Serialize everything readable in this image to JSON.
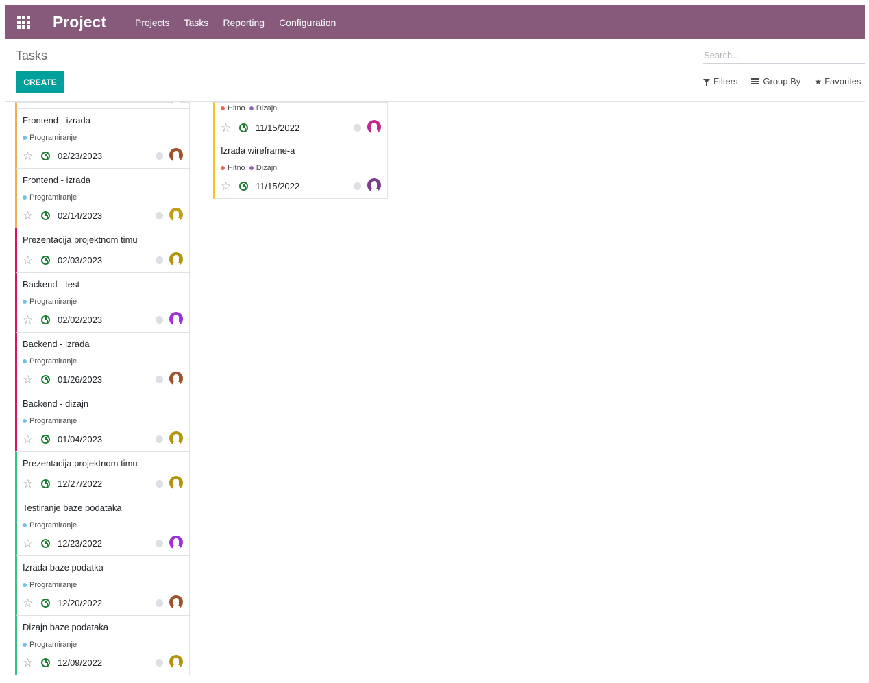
{
  "navbar": {
    "app_name": "Project",
    "menu": [
      "Projects",
      "Tasks",
      "Reporting",
      "Configuration"
    ]
  },
  "control_panel": {
    "breadcrumb": "Tasks",
    "create_label": "CREATE",
    "search_placeholder": "Search...",
    "filters_label": "Filters",
    "group_by_label": "Group By",
    "favorites_label": "Favorites"
  },
  "colors": {
    "navbar": "#875a7b",
    "create": "#00a09d",
    "orange": "#f0ad4e",
    "crimson": "#d6145f",
    "green": "#30c381",
    "yellow": "#f4c61a",
    "tag_blue": "#6cc1ed",
    "tag_red": "#f06050",
    "tag_purple": "#9365b8"
  },
  "column1": [
    {
      "title": "",
      "tags": [],
      "date": "",
      "color": "#f0ad4e",
      "avatar": "#a0522d",
      "partial": true
    },
    {
      "title": "Frontend - izrada",
      "tags": [
        {
          "name": "Programiranje",
          "color": "#6cc1ed"
        }
      ],
      "date": "02/23/2023",
      "color": "#f0ad4e",
      "avatar": "#a0522d"
    },
    {
      "title": "Frontend - izrada",
      "tags": [
        {
          "name": "Programiranje",
          "color": "#6cc1ed"
        }
      ],
      "date": "02/14/2023",
      "color": "#f0ad4e",
      "avatar": "#c29f17"
    },
    {
      "title": "Prezentacija projektnom timu",
      "tags": [],
      "date": "02/03/2023",
      "color": "#d6145f",
      "avatar": "#b5950f"
    },
    {
      "title": "Backend - test",
      "tags": [
        {
          "name": "Programiranje",
          "color": "#6cc1ed"
        }
      ],
      "date": "02/02/2023",
      "color": "#d6145f",
      "avatar": "#a033d6"
    },
    {
      "title": "Backend - izrada",
      "tags": [
        {
          "name": "Programiranje",
          "color": "#6cc1ed"
        }
      ],
      "date": "01/26/2023",
      "color": "#d6145f",
      "avatar": "#a0522d"
    },
    {
      "title": "Backend - dizajn",
      "tags": [
        {
          "name": "Programiranje",
          "color": "#6cc1ed"
        }
      ],
      "date": "01/04/2023",
      "color": "#d6145f",
      "avatar": "#b5950f"
    },
    {
      "title": "Prezentacija projektnom timu",
      "tags": [],
      "date": "12/27/2022",
      "color": "#30c381",
      "avatar": "#b5950f"
    },
    {
      "title": "Testiranje baze podataka",
      "tags": [
        {
          "name": "Programiranje",
          "color": "#6cc1ed"
        }
      ],
      "date": "12/23/2022",
      "color": "#30c381",
      "avatar": "#a033d6"
    },
    {
      "title": "Izrada baze podatka",
      "tags": [
        {
          "name": "Programiranje",
          "color": "#6cc1ed"
        }
      ],
      "date": "12/20/2022",
      "color": "#30c381",
      "avatar": "#a0522d"
    },
    {
      "title": "Dizajn baze podataka",
      "tags": [
        {
          "name": "Programiranje",
          "color": "#6cc1ed"
        }
      ],
      "date": "12/09/2022",
      "color": "#30c381",
      "avatar": "#b5950f"
    }
  ],
  "column2": [
    {
      "title": "",
      "tags": [
        {
          "name": "Hitno",
          "color": "#f06050"
        },
        {
          "name": "Dizajn",
          "color": "#9365b8"
        }
      ],
      "date": "11/15/2022",
      "color": "#f4c61a",
      "avatar": "#c2288f",
      "partial": true
    },
    {
      "title": "Izrada wireframe-a",
      "tags": [
        {
          "name": "Hitno",
          "color": "#f06050"
        },
        {
          "name": "Dizajn",
          "color": "#9365b8"
        }
      ],
      "date": "11/15/2022",
      "color": "#f4c61a",
      "avatar": "#7a3d8f"
    }
  ]
}
